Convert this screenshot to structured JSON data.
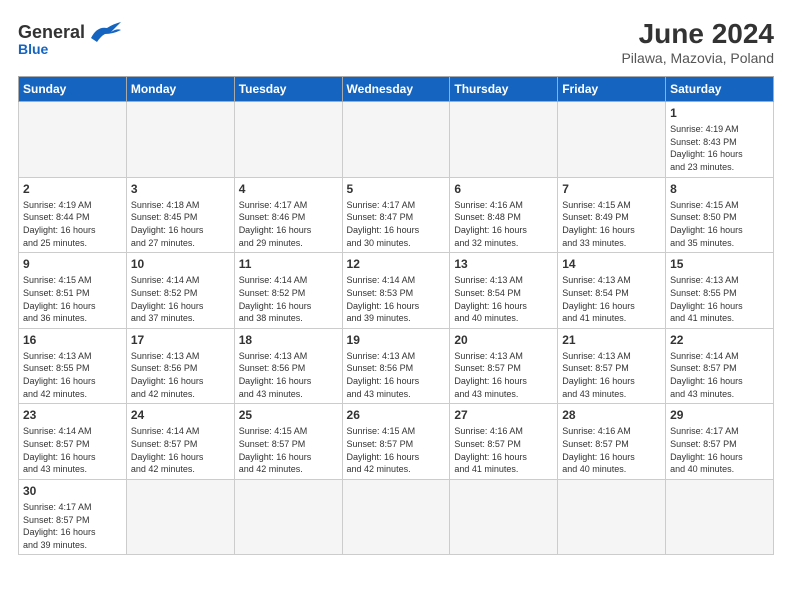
{
  "header": {
    "logo_general": "General",
    "logo_blue": "Blue",
    "month_year": "June 2024",
    "location": "Pilawa, Mazovia, Poland"
  },
  "days_of_week": [
    "Sunday",
    "Monday",
    "Tuesday",
    "Wednesday",
    "Thursday",
    "Friday",
    "Saturday"
  ],
  "weeks": [
    [
      {
        "day": null,
        "info": null
      },
      {
        "day": null,
        "info": null
      },
      {
        "day": null,
        "info": null
      },
      {
        "day": null,
        "info": null
      },
      {
        "day": null,
        "info": null
      },
      {
        "day": null,
        "info": null
      },
      {
        "day": "1",
        "info": "Sunrise: 4:19 AM\nSunset: 8:43 PM\nDaylight: 16 hours\nand 23 minutes."
      }
    ],
    [
      {
        "day": "2",
        "info": "Sunrise: 4:19 AM\nSunset: 8:44 PM\nDaylight: 16 hours\nand 25 minutes."
      },
      {
        "day": "3",
        "info": "Sunrise: 4:18 AM\nSunset: 8:45 PM\nDaylight: 16 hours\nand 27 minutes."
      },
      {
        "day": "4",
        "info": "Sunrise: 4:17 AM\nSunset: 8:46 PM\nDaylight: 16 hours\nand 29 minutes."
      },
      {
        "day": "5",
        "info": "Sunrise: 4:17 AM\nSunset: 8:47 PM\nDaylight: 16 hours\nand 30 minutes."
      },
      {
        "day": "6",
        "info": "Sunrise: 4:16 AM\nSunset: 8:48 PM\nDaylight: 16 hours\nand 32 minutes."
      },
      {
        "day": "7",
        "info": "Sunrise: 4:15 AM\nSunset: 8:49 PM\nDaylight: 16 hours\nand 33 minutes."
      },
      {
        "day": "8",
        "info": "Sunrise: 4:15 AM\nSunset: 8:50 PM\nDaylight: 16 hours\nand 35 minutes."
      }
    ],
    [
      {
        "day": "9",
        "info": "Sunrise: 4:15 AM\nSunset: 8:51 PM\nDaylight: 16 hours\nand 36 minutes."
      },
      {
        "day": "10",
        "info": "Sunrise: 4:14 AM\nSunset: 8:52 PM\nDaylight: 16 hours\nand 37 minutes."
      },
      {
        "day": "11",
        "info": "Sunrise: 4:14 AM\nSunset: 8:52 PM\nDaylight: 16 hours\nand 38 minutes."
      },
      {
        "day": "12",
        "info": "Sunrise: 4:14 AM\nSunset: 8:53 PM\nDaylight: 16 hours\nand 39 minutes."
      },
      {
        "day": "13",
        "info": "Sunrise: 4:13 AM\nSunset: 8:54 PM\nDaylight: 16 hours\nand 40 minutes."
      },
      {
        "day": "14",
        "info": "Sunrise: 4:13 AM\nSunset: 8:54 PM\nDaylight: 16 hours\nand 41 minutes."
      },
      {
        "day": "15",
        "info": "Sunrise: 4:13 AM\nSunset: 8:55 PM\nDaylight: 16 hours\nand 41 minutes."
      }
    ],
    [
      {
        "day": "16",
        "info": "Sunrise: 4:13 AM\nSunset: 8:55 PM\nDaylight: 16 hours\nand 42 minutes."
      },
      {
        "day": "17",
        "info": "Sunrise: 4:13 AM\nSunset: 8:56 PM\nDaylight: 16 hours\nand 42 minutes."
      },
      {
        "day": "18",
        "info": "Sunrise: 4:13 AM\nSunset: 8:56 PM\nDaylight: 16 hours\nand 43 minutes."
      },
      {
        "day": "19",
        "info": "Sunrise: 4:13 AM\nSunset: 8:56 PM\nDaylight: 16 hours\nand 43 minutes."
      },
      {
        "day": "20",
        "info": "Sunrise: 4:13 AM\nSunset: 8:57 PM\nDaylight: 16 hours\nand 43 minutes."
      },
      {
        "day": "21",
        "info": "Sunrise: 4:13 AM\nSunset: 8:57 PM\nDaylight: 16 hours\nand 43 minutes."
      },
      {
        "day": "22",
        "info": "Sunrise: 4:14 AM\nSunset: 8:57 PM\nDaylight: 16 hours\nand 43 minutes."
      }
    ],
    [
      {
        "day": "23",
        "info": "Sunrise: 4:14 AM\nSunset: 8:57 PM\nDaylight: 16 hours\nand 43 minutes."
      },
      {
        "day": "24",
        "info": "Sunrise: 4:14 AM\nSunset: 8:57 PM\nDaylight: 16 hours\nand 42 minutes."
      },
      {
        "day": "25",
        "info": "Sunrise: 4:15 AM\nSunset: 8:57 PM\nDaylight: 16 hours\nand 42 minutes."
      },
      {
        "day": "26",
        "info": "Sunrise: 4:15 AM\nSunset: 8:57 PM\nDaylight: 16 hours\nand 42 minutes."
      },
      {
        "day": "27",
        "info": "Sunrise: 4:16 AM\nSunset: 8:57 PM\nDaylight: 16 hours\nand 41 minutes."
      },
      {
        "day": "28",
        "info": "Sunrise: 4:16 AM\nSunset: 8:57 PM\nDaylight: 16 hours\nand 40 minutes."
      },
      {
        "day": "29",
        "info": "Sunrise: 4:17 AM\nSunset: 8:57 PM\nDaylight: 16 hours\nand 40 minutes."
      }
    ],
    [
      {
        "day": "30",
        "info": "Sunrise: 4:17 AM\nSunset: 8:57 PM\nDaylight: 16 hours\nand 39 minutes."
      },
      {
        "day": null,
        "info": null
      },
      {
        "day": null,
        "info": null
      },
      {
        "day": null,
        "info": null
      },
      {
        "day": null,
        "info": null
      },
      {
        "day": null,
        "info": null
      },
      {
        "day": null,
        "info": null
      }
    ]
  ]
}
